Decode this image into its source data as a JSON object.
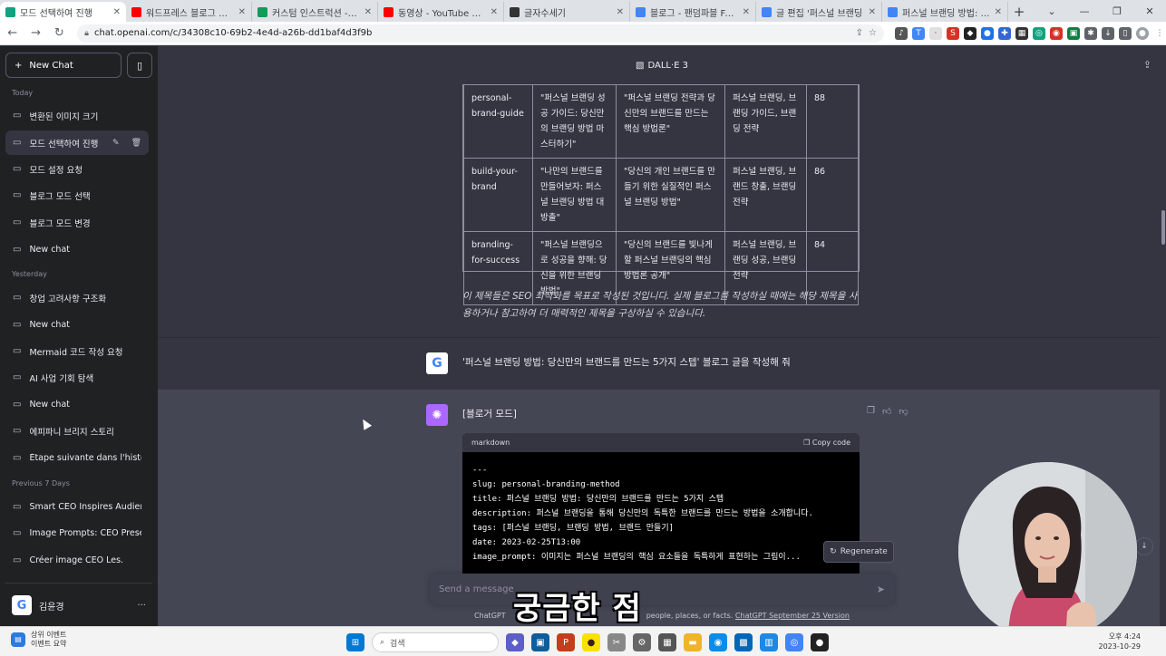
{
  "browser": {
    "tabs": [
      {
        "title": "모드 선택하여 진행",
        "color": "#10a37f",
        "active": true
      },
      {
        "title": "워드프레스 블로그 키워드",
        "color": "#ff0000",
        "active": false
      },
      {
        "title": "커스텀 인스트럭션 - Goo",
        "color": "#0f9d58",
        "active": false
      },
      {
        "title": "동영상 - YouTube Studio",
        "color": "#ff0000",
        "active": false
      },
      {
        "title": "글자수세기",
        "color": "#333333",
        "active": false
      },
      {
        "title": "블로그 - 팬덤파블 Fando",
        "color": "#4285f4",
        "active": false
      },
      {
        "title": "글 편집 '퍼스널 브랜딩",
        "color": "#4285f4",
        "active": false
      },
      {
        "title": "퍼스널 브랜딩 방법: 당신",
        "color": "#4285f4",
        "active": false
      }
    ],
    "new_tab_label": "+",
    "url": "chat.openai.com/c/34308c10-69b2-4e4d-a26b-dd1baf4d3f9b"
  },
  "sidebar": {
    "new_chat_label": "New Chat",
    "groups": [
      {
        "label": "Today"
      },
      {
        "label": "Yesterday"
      },
      {
        "label": "Previous 7 Days"
      }
    ],
    "items": [
      {
        "label": "변환된 이미지 크기"
      },
      {
        "label": "모드 선택하여 진행"
      },
      {
        "label": "모드 설정 요청"
      },
      {
        "label": "블로그 모드 선택"
      },
      {
        "label": "블로그 모드 변경"
      },
      {
        "label": "New chat"
      },
      {
        "label": "창업 고려사항 구조화"
      },
      {
        "label": "New chat"
      },
      {
        "label": "Mermaid 코드 작성 요청"
      },
      {
        "label": "AI 사업 기회 탐색"
      },
      {
        "label": "New chat"
      },
      {
        "label": "에피파니 브리지 스토리"
      },
      {
        "label": "Étape suivante dans l'histoire"
      },
      {
        "label": "Smart CEO Inspires Audience"
      },
      {
        "label": "Image Prompts: CEO Present"
      },
      {
        "label": "Créer image CEO Les."
      }
    ],
    "user_name": "김윤경",
    "user_initial": "G"
  },
  "header": {
    "model": "DALL·E 3"
  },
  "table": {
    "rows": [
      [
        "personal-brand-guide",
        "\"퍼스널 브랜딩 성공 가이드: 당신만의 브랜딩 방법 마스터하기\"",
        "\"퍼스널 브랜딩 전략과 당신만의 브랜드를 만드는 핵심 방법론\"",
        "퍼스널 브랜딩, 브랜딩 가이드, 브랜딩 전략",
        "88"
      ],
      [
        "build-your-brand",
        "\"나만의 브랜드를 만들어보자: 퍼스널 브랜딩 방법 대방출\"",
        "\"당신의 개인 브랜드를 만들기 위한 실질적인 퍼스널 브랜딩 방법\"",
        "퍼스널 브랜딩, 브랜드 창출, 브랜딩 전략",
        "86"
      ],
      [
        "branding-for-success",
        "\"퍼스널 브랜딩으로 성공을 향해: 당신을 위한 브랜딩 방법\"",
        "\"당신의 브랜드를 빛나게 할 퍼스널 브랜딩의 핵심 방법론 공개\"",
        "퍼스널 브랜딩, 브랜딩 성공, 브랜딩 전략",
        "84"
      ]
    ]
  },
  "assistant_note": "이 제목들은 SEO 최적화를 목표로 작성된 것입니다. 실제 블로그를 작성하실 때에는 해당 제목을 사용하거나 참고하여 더 매력적인 제목을 구상하실 수 있습니다.",
  "user_message": {
    "avatar": "G",
    "text": "'퍼스널 브랜딩 방법: 당신만의 브랜드를 만드는 5가지 스텝' 블로그 글을 작성해 줘"
  },
  "assistant_message": {
    "text": "[블로거 모드]",
    "code_lang": "markdown",
    "copy_label": "Copy code",
    "code_lines": [
      "---",
      "slug: personal-branding-method",
      "title: 퍼스널 브랜딩 방법: 당신만의 브랜드를 만드는 5가지 스텝",
      "description: 퍼스널 브랜딩을 통해 당신만의 독특한 브랜드를 만드는 방법을 소개합니다.",
      "tags: [퍼스널 브랜딩, 브랜딩 방법, 브랜드 만들기]",
      "date: 2023-02-25T13:00",
      "image_prompt: 이미지는 퍼스널 브랜딩의 핵심 요소들을 독특하게 표현하는 그림이..."
    ]
  },
  "regenerate_label": "Regenerate",
  "input": {
    "placeholder": "Send a message"
  },
  "footer": {
    "text_before": "ChatGPT",
    "text_after": "people, places, or facts.",
    "link": "ChatGPT September 25 Version"
  },
  "video_subtitle": "궁금한 점",
  "taskbar": {
    "news_title": "상위 이벤트",
    "news_sub": "이벤트 요약",
    "search_placeholder": "검색",
    "time": "오후 4:24",
    "date": "2023-10-29"
  }
}
